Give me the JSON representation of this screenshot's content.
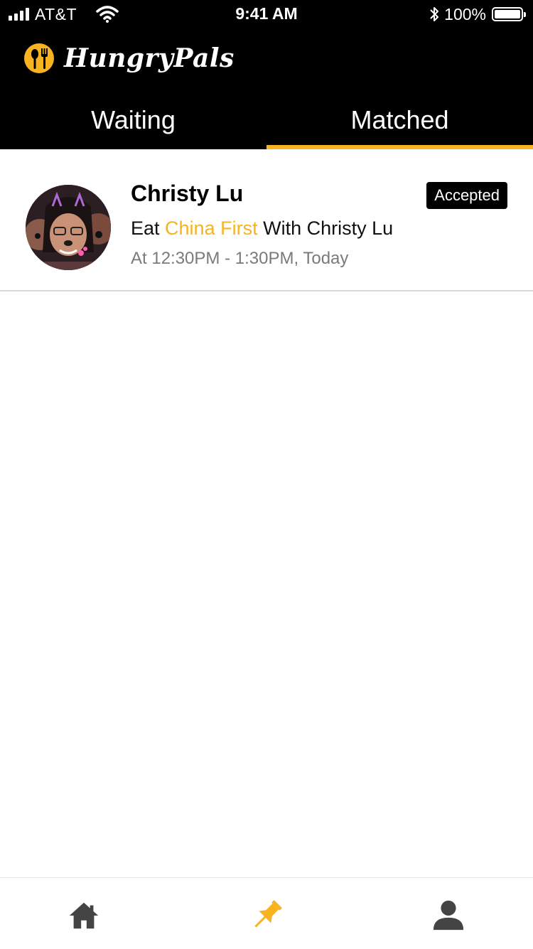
{
  "status_bar": {
    "carrier": "AT&T",
    "time": "9:41 AM",
    "battery": "100%",
    "signal_icon": "signal-bars-icon",
    "wifi_icon": "wifi-icon",
    "bluetooth_icon": "bluetooth-icon",
    "battery_icon": "battery-icon"
  },
  "header": {
    "app_name": "HungryPals",
    "logo_icon": "utensils-logo-icon"
  },
  "tabs": [
    {
      "label": "Waiting",
      "active": false
    },
    {
      "label": "Matched",
      "active": true
    }
  ],
  "matches": [
    {
      "name": "Christy Lu",
      "status": "Accepted",
      "eat_prefix": "Eat",
      "restaurant": "China First",
      "with_text": "With Christy Lu",
      "time": "At 12:30PM - 1:30PM,",
      "day": "Today"
    }
  ],
  "bottom_nav": [
    {
      "icon": "home-icon",
      "active": false
    },
    {
      "icon": "pin-icon",
      "active": true
    },
    {
      "icon": "profile-icon",
      "active": false
    }
  ],
  "colors": {
    "accent": "#f7b320",
    "header_bg": "#000000",
    "icon_inactive": "#444444"
  }
}
